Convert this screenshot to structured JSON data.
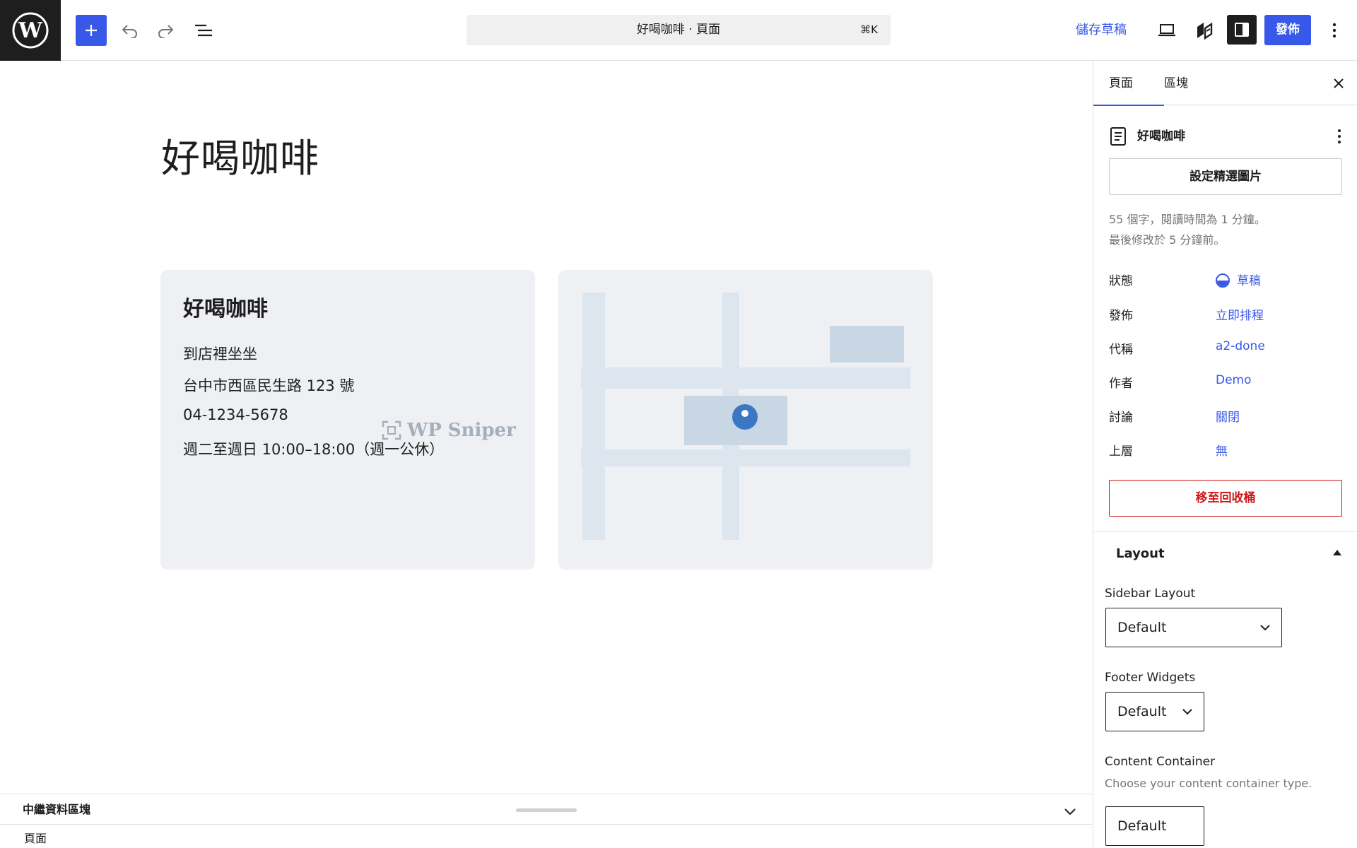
{
  "toolbar": {
    "command_title": "好喝咖啡 · 頁面",
    "command_shortcut": "⌘K",
    "save_draft": "儲存草稿",
    "publish": "發佈",
    "icons": [
      "wordpress-logo",
      "plus-icon",
      "undo-icon",
      "redo-icon",
      "list-view-icon",
      "desktop-view-icon",
      "jetpack-icon",
      "sidebar-toggle-icon",
      "more-vertical-icon"
    ]
  },
  "canvas": {
    "page_title": "好喝咖啡",
    "card": {
      "heading": "好喝咖啡",
      "lines": [
        "到店裡坐坐",
        "台中市西區民生路 123 號",
        "04-1234-5678",
        "週二至週日 10:00–18:00（週一公休）"
      ]
    },
    "watermark": "WP Sniper"
  },
  "bottom": {
    "meta_panel_label": "中繼資料區塊",
    "breadcrumb": "頁面"
  },
  "sidebar": {
    "tabs": [
      {
        "label": "頁面",
        "active": true
      },
      {
        "label": "區塊",
        "active": false
      }
    ],
    "summary_title": "好喝咖啡",
    "featured_image_button": "設定精選圖片",
    "word_count_text": "55 個字，閱讀時間為 1 分鐘。",
    "last_modified_text": "最後修改於 5 分鐘前。",
    "rows": [
      {
        "label": "狀態",
        "value": "草稿"
      },
      {
        "label": "發佈",
        "value": "立即排程"
      },
      {
        "label": "代稱",
        "value": "a2-done"
      },
      {
        "label": "作者",
        "value": "Demo"
      },
      {
        "label": "討論",
        "value": "關閉"
      },
      {
        "label": "上層",
        "value": "無"
      }
    ],
    "trash_button": "移至回收桶",
    "layout": {
      "heading": "Layout",
      "sidebar_layout_label": "Sidebar Layout",
      "sidebar_layout_value": "Default",
      "footer_widgets_label": "Footer Widgets",
      "footer_widgets_value": "Default",
      "content_container_label": "Content Container",
      "content_container_help": "Choose your content container type.",
      "content_container_value": "Default"
    }
  },
  "colors": {
    "accent": "#3858e9",
    "danger": "#cc1818",
    "card_bg": "#eef0f4",
    "map_road": "#dde5ef",
    "map_block": "#c9d6e3",
    "map_pin": "#3a78c4"
  }
}
